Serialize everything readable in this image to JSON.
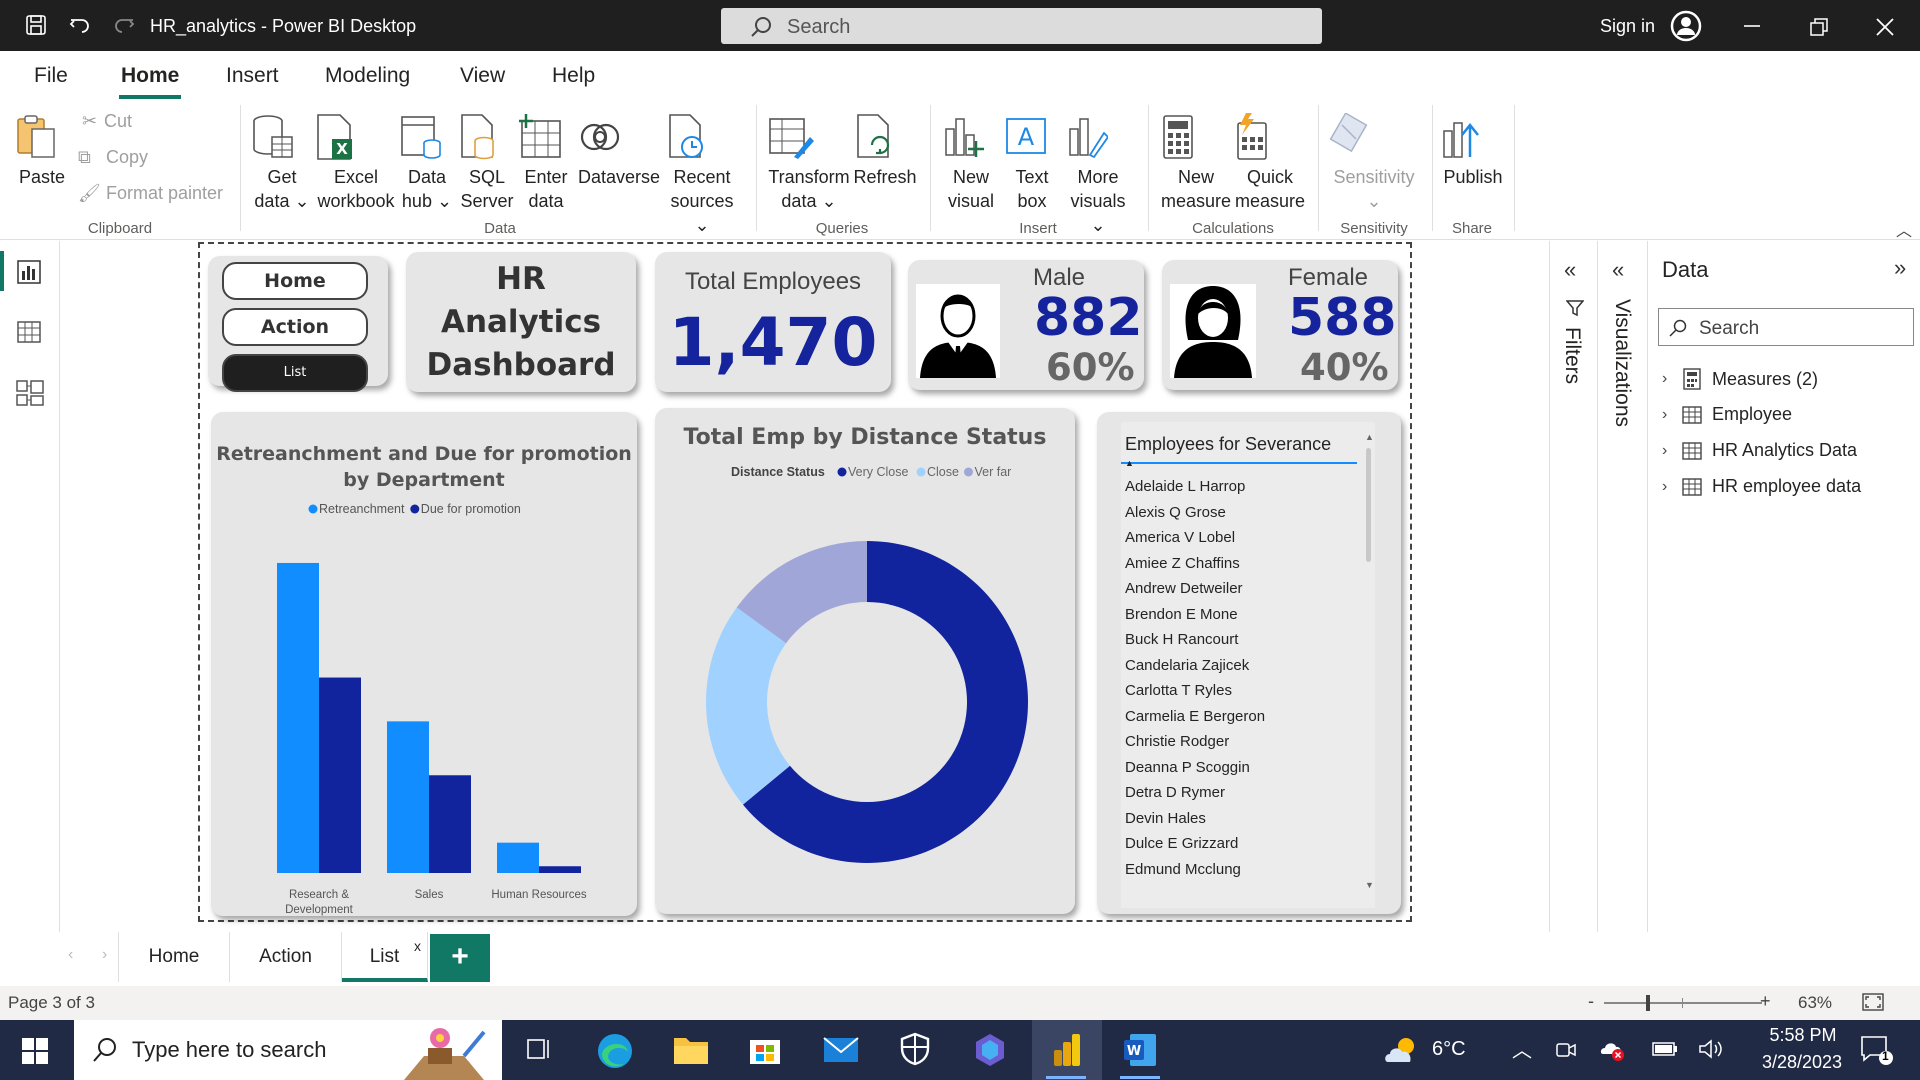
{
  "window": {
    "title": "HR_analytics - Power BI Desktop",
    "search_placeholder": "Search",
    "sign_in": "Sign in"
  },
  "menu": {
    "tabs": [
      "File",
      "Home",
      "Insert",
      "Modeling",
      "View",
      "Help"
    ],
    "active": "Home"
  },
  "ribbon": {
    "clipboard": {
      "paste": "Paste",
      "cut": "Cut",
      "copy": "Copy",
      "format_painter": "Format painter",
      "label": "Clipboard"
    },
    "data": {
      "get_data": [
        "Get",
        "data"
      ],
      "excel": [
        "Excel",
        "workbook"
      ],
      "data_hub": [
        "Data",
        "hub"
      ],
      "sql": [
        "SQL",
        "Server"
      ],
      "enter": [
        "Enter",
        "data"
      ],
      "dataverse": "Dataverse",
      "recent": [
        "Recent",
        "sources"
      ],
      "label": "Data"
    },
    "queries": {
      "transform": [
        "Transform",
        "data"
      ],
      "refresh": "Refresh",
      "label": "Queries"
    },
    "insert": {
      "new_visual": [
        "New",
        "visual"
      ],
      "text_box": [
        "Text",
        "box"
      ],
      "more_visuals": [
        "More",
        "visuals"
      ],
      "label": "Insert"
    },
    "calculations": {
      "new_measure": [
        "New",
        "measure"
      ],
      "quick_measure": [
        "Quick",
        "measure"
      ],
      "label": "Calculations"
    },
    "sensitivity": {
      "button": "Sensitivity",
      "label": "Sensitivity"
    },
    "share": {
      "publish": "Publish",
      "label": "Share"
    }
  },
  "report": {
    "nav_buttons": {
      "home": "Home",
      "action": "Action",
      "list": "List"
    },
    "title_lines": [
      "HR",
      "Analytics",
      "Dashboard"
    ],
    "total_employees": {
      "label": "Total Employees",
      "value": "1,470"
    },
    "male": {
      "label": "Male",
      "value": "882",
      "pct": "60%"
    },
    "female": {
      "label": "Female",
      "value": "588",
      "pct": "40%"
    },
    "severance": {
      "header": "Employees for Severance",
      "names": [
        "Adelaide L Harrop",
        "Alexis Q Grose",
        "America V Lobel",
        "Amiee Z Chaffins",
        "Andrew Detweiler",
        "Brendon E Mone",
        "Buck H Rancourt",
        "Candelaria Zajicek",
        "Carlotta T Ryles",
        "Carmelia E Bergeron",
        "Christie Rodger",
        "Deanna P Scoggin",
        "Detra D Rymer",
        "Devin Hales",
        "Dulce E Grizzard",
        "Edmund Mcclung"
      ]
    }
  },
  "chart_data": [
    {
      "type": "bar",
      "title": "Retreanchment and Due for promotion by Department",
      "categories": [
        "Research & Development",
        "Sales",
        "Human Resources"
      ],
      "category_lines": [
        [
          "Research &",
          "Development"
        ],
        [
          "Sales"
        ],
        [
          "Human Resources"
        ]
      ],
      "series": [
        {
          "name": "Retreanchment",
          "values": [
            92,
            45,
            9
          ],
          "color": "#118dff"
        },
        {
          "name": "Due for promotion",
          "values": [
            58,
            29,
            2
          ],
          "color": "#12239e"
        }
      ],
      "legend_position": "top-center",
      "ylim": [
        0,
        100
      ]
    },
    {
      "type": "pie",
      "title": "Total Emp by Distance Status",
      "legend_title": "Distance Status",
      "hole": true,
      "slices": [
        {
          "name": "Very Close",
          "value": 64,
          "color": "#12239e"
        },
        {
          "name": "Close",
          "value": 21,
          "color": "#a0d1ff"
        },
        {
          "name": "Ver far",
          "value": 15,
          "color": "#a1a6d8"
        }
      ],
      "legend_position": "top-center"
    }
  ],
  "sheets": {
    "tabs": [
      "Home",
      "Action",
      "List"
    ],
    "active": "List",
    "close": "x",
    "add": "+"
  },
  "status": {
    "page": "Page 3 of 3",
    "zoom": "63%",
    "zoom_minus": "-",
    "zoom_plus": "+"
  },
  "panes": {
    "filters": "Filters",
    "visualizations": "Visualizations",
    "data": {
      "title": "Data",
      "search_placeholder": "Search",
      "items": [
        "Measures (2)",
        "Employee",
        "HR Analytics Data",
        "HR employee data"
      ]
    }
  },
  "taskbar": {
    "search_placeholder": "Type here to search",
    "weather": "6°C",
    "time": "5:58 PM",
    "date": "3/28/2023",
    "notif_count": "1"
  }
}
